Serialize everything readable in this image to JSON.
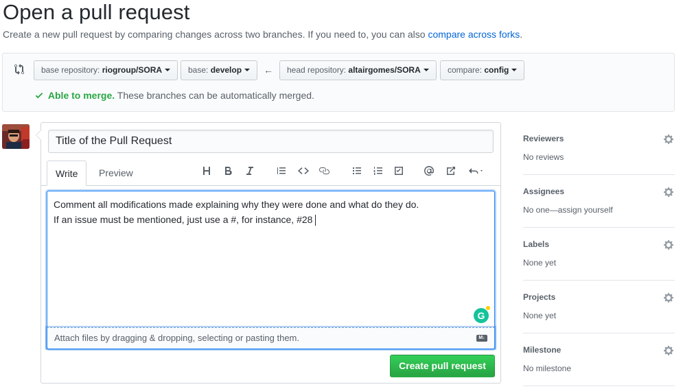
{
  "page": {
    "title": "Open a pull request",
    "subtitle_text": "Create a new pull request by comparing changes across two branches. If you need to, you can also ",
    "subtitle_link": "compare across forks",
    "subtitle_end": "."
  },
  "range": {
    "base_repo_label": "base repository: ",
    "base_repo_value": "riogroup/SORA",
    "base_label": "base: ",
    "base_value": "develop",
    "head_repo_label": "head repository: ",
    "head_repo_value": "altairgomes/SORA",
    "compare_label": "compare: ",
    "compare_value": "config",
    "arrow": "←",
    "merge_ok": "Able to merge.",
    "merge_text": " These branches can be automatically merged."
  },
  "composer": {
    "title_value": "Title of the Pull Request",
    "tab_write": "Write",
    "tab_preview": "Preview",
    "body_line1": "Comment all modifications made explaining why they were done and what do they do.",
    "body_line2": "If an issue must be mentioned, just use a #, for instance, #28",
    "attach_text": "Attach files by dragging & dropping, selecting or pasting them.",
    "submit_label": "Create pull request",
    "toolbar_icons": [
      "header-icon",
      "bold-icon",
      "italic-icon",
      "quote-icon",
      "code-icon",
      "link-icon",
      "bulleted-list-icon",
      "numbered-list-icon",
      "task-list-icon",
      "mention-icon",
      "reference-icon",
      "reply-icon"
    ]
  },
  "sidebar": {
    "sections": [
      {
        "title": "Reviewers",
        "value": "No reviews"
      },
      {
        "title": "Assignees",
        "value": "No one—assign yourself"
      },
      {
        "title": "Labels",
        "value": "None yet"
      },
      {
        "title": "Projects",
        "value": "None yet"
      },
      {
        "title": "Milestone",
        "value": "No milestone"
      }
    ]
  },
  "colors": {
    "link": "#0366d6",
    "success": "#28a745",
    "focus": "#2188ff"
  }
}
